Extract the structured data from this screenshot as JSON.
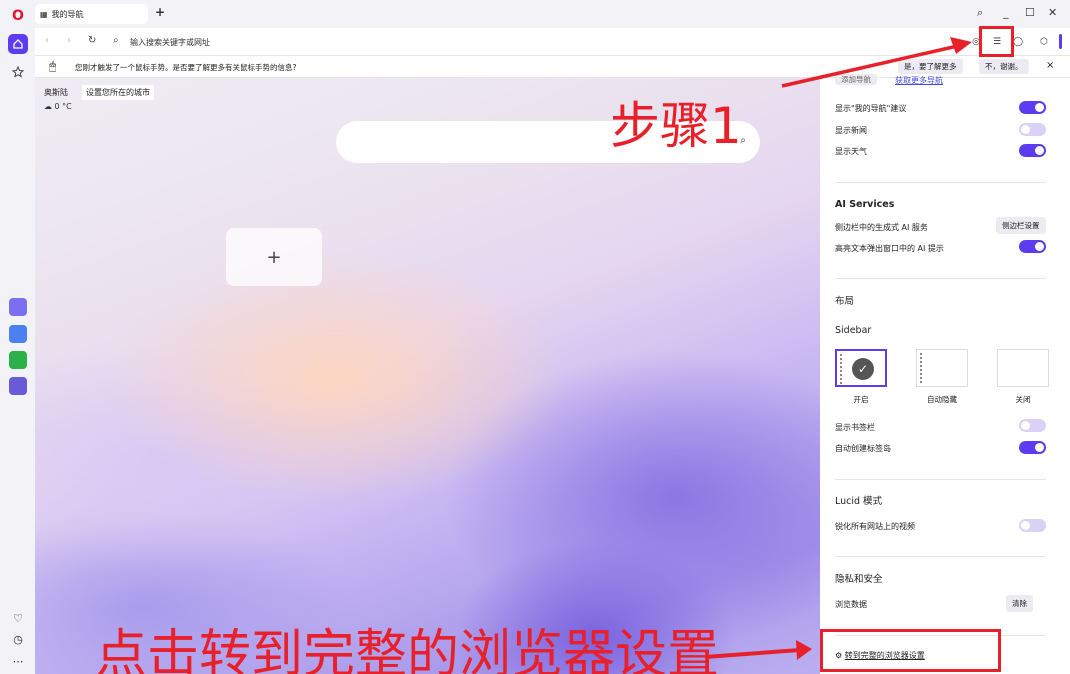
{
  "tab": {
    "title": "我的导航"
  },
  "address": {
    "placeholder": "输入搜索关键字或网址"
  },
  "notification": {
    "text": "您刚才触发了一个鼠标手势。是否要了解更多有关鼠标手势的信息?",
    "yes": "是，要了解更多",
    "no": "不，谢谢。",
    "close": "×"
  },
  "weather": {
    "city": "奥斯陆",
    "set_city": "设置您所在的城市",
    "temp": "0 °C"
  },
  "speed_dial": {
    "add": "+"
  },
  "panel": {
    "top_partial_1": "添加导航",
    "top_partial_2": "获取更多导航",
    "show_suggestions": "显示\"我的导航\"建议",
    "show_news": "显示新闻",
    "show_weather": "显示天气",
    "ai_title": "AI Services",
    "ai_sidebar": "侧边栏中的生成式 AI 服务",
    "ai_sidebar_btn": "侧边栏设置",
    "ai_highlight": "高亮文本弹出窗口中的 AI 提示",
    "layout_title": "布局",
    "sidebar_title": "Sidebar",
    "opt_on": "开启",
    "opt_auto": "自动隐藏",
    "opt_off": "关闭",
    "show_bookmarks": "显示书签栏",
    "auto_islands": "自动创建标签岛",
    "lucid_title": "Lucid 模式",
    "lucid_sharpen": "锐化所有网站上的视频",
    "privacy_title": "隐私和安全",
    "browse_data": "浏览数据",
    "clear_btn": "清除",
    "full_settings": "转到完整的浏览器设置"
  },
  "annotations": {
    "step1": "步骤1",
    "bottom": "点击转到完整的浏览器设置"
  },
  "colors": {
    "accent": "#5c3cf0",
    "annotation": "#e8202a"
  }
}
